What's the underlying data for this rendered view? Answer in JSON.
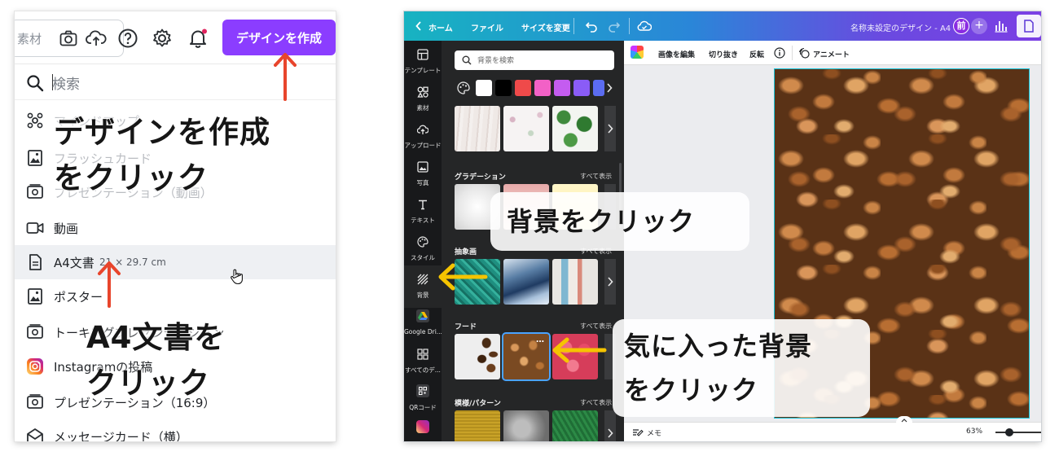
{
  "left": {
    "search_pill_text": "素材",
    "create_button": "デザインを作成",
    "menu_search_placeholder": "検索",
    "menu_items": [
      {
        "label": "マインドマップ"
      },
      {
        "label": "フラッシュカード"
      },
      {
        "label": "プレゼンテーション（動画）"
      },
      {
        "label": "動画"
      },
      {
        "label": "A4文書",
        "sub": "21 × 29.7 cm"
      },
      {
        "label": "ポスター"
      },
      {
        "label": "トーキングプレゼンテーション"
      },
      {
        "label": "Instagramの投稿"
      },
      {
        "label": "プレゼンテーション（16:9）"
      },
      {
        "label": "メッセージカード（横）"
      }
    ],
    "callout_create_line1": "デザインを作成",
    "callout_create_line2": "をクリック",
    "callout_a4_line1": "A4文書を",
    "callout_a4_line2": "クリック",
    "arrow_color": "#e8452c",
    "accent_color": "#8b3dff"
  },
  "right": {
    "topbar": {
      "home": "ホーム",
      "file": "ファイル",
      "resize": "サイズを変更",
      "doc_title": "名称未設定のデザイン - A4",
      "avatar": "前"
    },
    "sidebar": [
      {
        "label": "テンプレート",
        "icon": "template-icon"
      },
      {
        "label": "素材",
        "icon": "elements-icon"
      },
      {
        "label": "アップロード",
        "icon": "upload-icon"
      },
      {
        "label": "写真",
        "icon": "photo-icon"
      },
      {
        "label": "テキスト",
        "icon": "text-icon"
      },
      {
        "label": "スタイル",
        "icon": "style-icon"
      },
      {
        "label": "背景",
        "icon": "background-icon"
      },
      {
        "label": "Google Dri...",
        "icon": "google-drive-icon"
      },
      {
        "label": "すべてのデ...",
        "icon": "all-designs-icon"
      },
      {
        "label": "QRコード",
        "icon": "qr-code-icon"
      }
    ],
    "panel": {
      "search_placeholder": "背景を検索",
      "swatches": [
        "#ffffff",
        "#000000",
        "#ef4a4a",
        "#f261c6",
        "#c45cf0",
        "#8a5cf6",
        "#5b6cf0"
      ],
      "sections": [
        {
          "title": "グラデーション",
          "see_all": "すべて表示"
        },
        {
          "title": "抽象画",
          "see_all": "すべて表示"
        },
        {
          "title": "フード",
          "see_all": "すべて表示"
        },
        {
          "title": "模様/パターン",
          "see_all": "すべて表示"
        }
      ]
    },
    "canvas_toolbar": {
      "edit_image": "画像を編集",
      "crop": "切り抜き",
      "flip": "反転",
      "animate": "アニメート"
    },
    "bottom": {
      "notes": "メモ",
      "zoom": "63%"
    },
    "callout_bg": "背景をクリック",
    "callout_fav_line1": "気に入った背景",
    "callout_fav_line2": "をクリック",
    "arrow_color": "#f5c400"
  }
}
